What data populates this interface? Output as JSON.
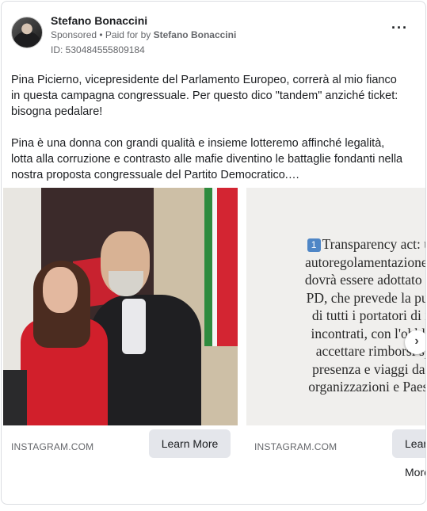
{
  "header": {
    "page_name": "Stefano Bonaccini",
    "sponsored": "Sponsored",
    "paid_for_prefix": " • Paid for by ",
    "paid_for_name": "Stefano Bonaccini",
    "ad_id": "ID: 530484555809184",
    "more_icon": "more-dots-icon"
  },
  "body": {
    "paragraph1": "Pina Picierno, vicepresidente del Parlamento Europeo, correrà al mio fianco in questa campagna congressuale. Per questo dico \"tandem\" anziché ticket: bisogna pedalare!",
    "paragraph2": "Pina è una donna con grandi qualità e insieme lotteremo affinché legalità, lotta alla corruzione e contrasto alle mafie diventino le battaglie fondanti nella nostra proposta congressuale del Partito Democratico.…"
  },
  "carousel": {
    "cards": [
      {
        "domain": "INSTAGRAM.COM",
        "cta": "Learn More"
      },
      {
        "domain": "INSTAGRAM.COM",
        "cta": "Learn More",
        "badge": "1",
        "lines": [
          "Transparency act: un cod",
          "autoregolamentazione intern",
          "dovrà essere adottato dagli o",
          "PD, che prevede la pubblica",
          "di tutti i portatori di intere",
          "incontrati, con l'obbligo di",
          "accettare rimborsi spese,",
          "presenza e viaggi da parte",
          "organizzazioni e Paesi terzi"
        ]
      }
    ],
    "next_icon": "chevron-right-icon"
  },
  "colors": {
    "text": "#1c1e21",
    "muted": "#65676b",
    "button_bg": "#e4e6eb",
    "border": "#dadde1"
  }
}
